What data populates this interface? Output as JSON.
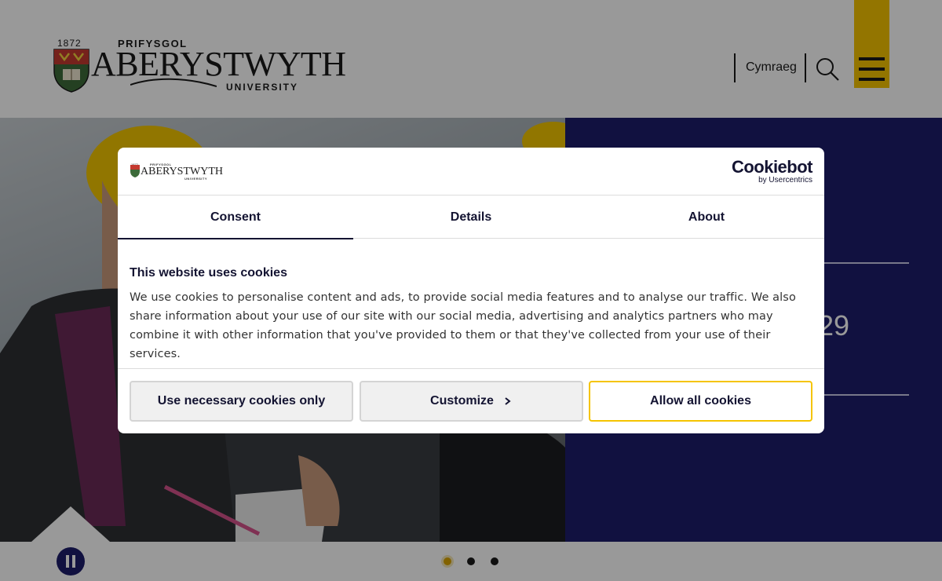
{
  "header": {
    "logo": {
      "year": "1872",
      "top_text": "PRIFYSGOL",
      "name": "ABERYSTWYTH",
      "bottom_text": "UNIVERSITY"
    },
    "language_link": "Cymraeg",
    "search_icon": "search-icon",
    "menu_icon": "hamburger-menu-icon",
    "menu_color": "#f5c400"
  },
  "hero": {
    "panel_color": "#1d1d6b",
    "partial_number": "29"
  },
  "carousel": {
    "pause_icon": "pause-icon",
    "slides": 3,
    "active_slide": 1,
    "active_color": "#d9a400"
  },
  "cookie_dialog": {
    "logo": {
      "year": "1872",
      "top_text": "PRIFYSGOL",
      "name": "ABERYSTWYTH",
      "bottom_text": "UNIVERSITY"
    },
    "brand": {
      "main": "Cookiebot",
      "sub": "by Usercentrics"
    },
    "tabs": [
      {
        "label": "Consent",
        "active": true
      },
      {
        "label": "Details",
        "active": false
      },
      {
        "label": "About",
        "active": false
      }
    ],
    "title": "This website uses cookies",
    "body": "We use cookies to personalise content and ads, to provide social media features and to analyse our traffic. We also share information about your use of our site with our social media, advertising and analytics partners who may combine it with other information that you've provided to them or that they've collected from your use of their services.",
    "buttons": {
      "necessary": "Use necessary cookies only",
      "customize": "Customize",
      "allow_all": "Allow all cookies"
    },
    "accent_color": "#f5c400",
    "text_color": "#141432"
  }
}
